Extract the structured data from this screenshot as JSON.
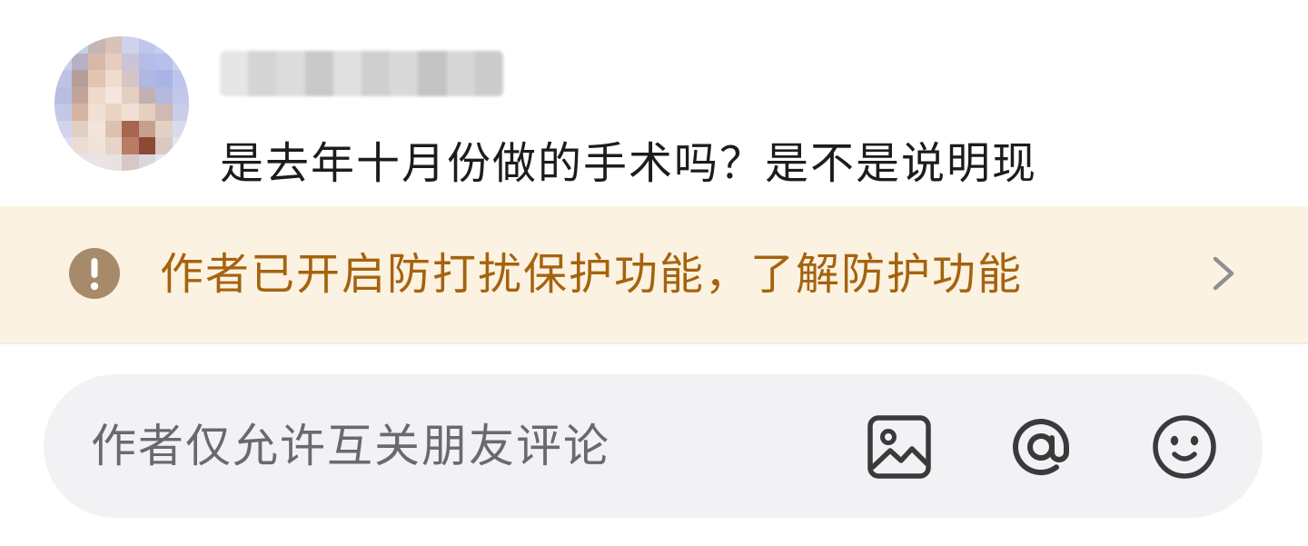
{
  "comment": {
    "username": "",
    "text_line1": "是去年十月份做的手术吗？是不是说明现",
    "text_line2": ""
  },
  "notice": {
    "icon": "exclamation-icon",
    "text": "作者已开启防打扰保护功能，了解防护功能",
    "chevron": "chevron-right-icon",
    "accent_color": "#a5630f",
    "background_color": "#fcf2e1"
  },
  "input_bar": {
    "placeholder": "作者仅允许互关朋友评论",
    "icons": [
      "image-icon",
      "at-icon",
      "emoji-icon"
    ]
  }
}
